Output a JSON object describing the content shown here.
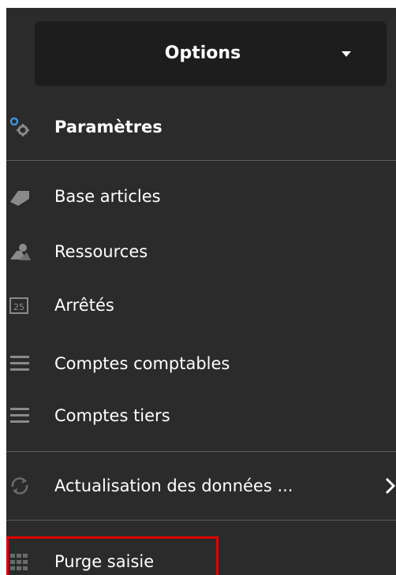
{
  "options_menu": {
    "header_label": "Options",
    "items": [
      {
        "label": "Paramètres",
        "icon": "settings-gears-icon"
      },
      {
        "label": "Base articles",
        "icon": "tag-icon"
      },
      {
        "label": "Ressources",
        "icon": "resources-icon"
      },
      {
        "label": "Arrêtés",
        "icon": "calendar-icon",
        "icon_text": "25"
      },
      {
        "label": "Comptes comptables",
        "icon": "list-icon"
      },
      {
        "label": "Comptes tiers",
        "icon": "list-icon"
      },
      {
        "label": "Actualisation des données ...",
        "icon": "refresh-icon",
        "has_submenu": true
      },
      {
        "label": "Purge saisie",
        "icon": "grid-icon"
      }
    ],
    "colors": {
      "panel_background": "#2b2b2b",
      "button_background": "#1d1d1d",
      "text": "#ffffff",
      "divider": "#5c5c5c",
      "highlight": "#e00000",
      "icon_blue": "#3f8fd6",
      "icon_grey": "#8a8a8a"
    }
  }
}
